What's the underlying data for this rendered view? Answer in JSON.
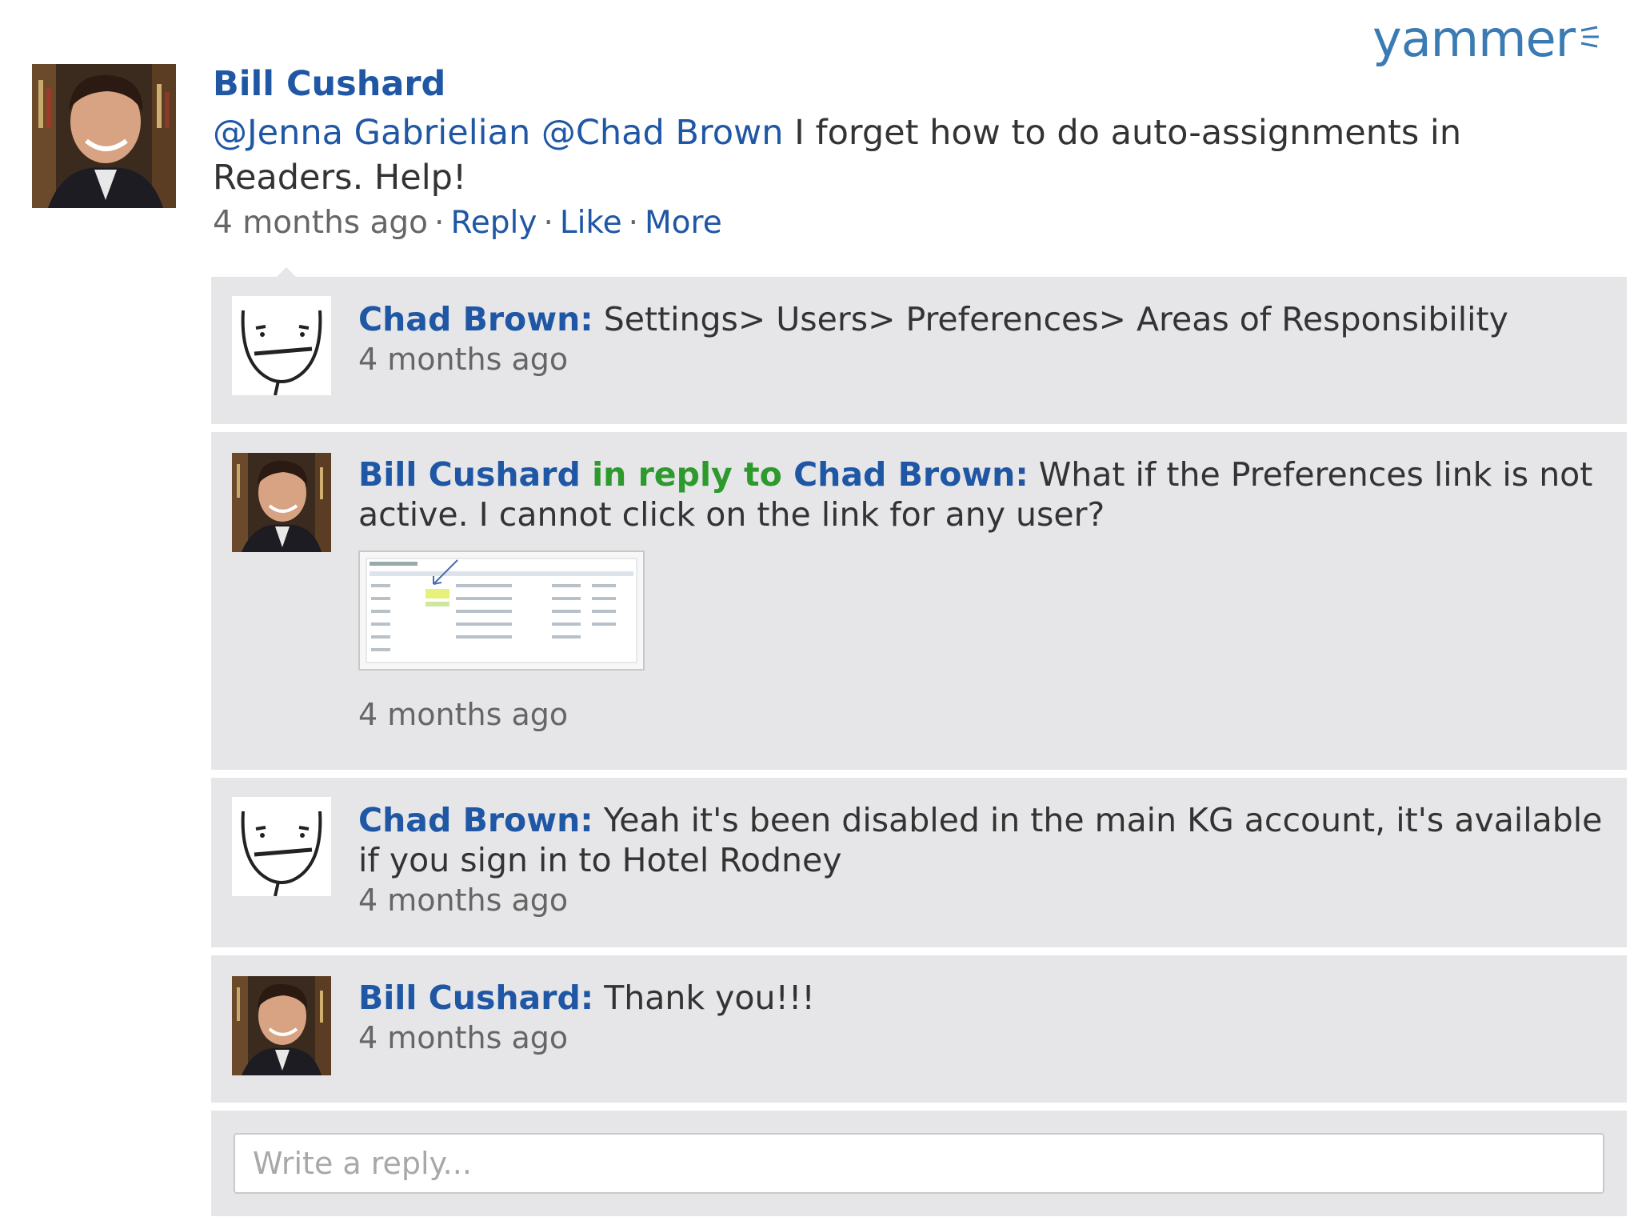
{
  "brand": {
    "logo_text": "yammer"
  },
  "post": {
    "author": "Bill Cushard",
    "mentions": [
      "@Jenna Gabrielian",
      "@Chad Brown"
    ],
    "text": " I forget how to do auto-assignments in Readers. Help!",
    "time": "4 months ago",
    "sep": "·",
    "actions": {
      "reply": "Reply",
      "like": "Like",
      "more": "More"
    }
  },
  "replies": [
    {
      "author": "Chad Brown:",
      "text": " Settings> Users> Preferences> Areas of Responsibility",
      "time": "4 months ago"
    },
    {
      "author": "Bill Cushard",
      "in_reply_to": " in reply to ",
      "reply_target": "Chad Brown:",
      "text": " What if the Preferences link is not active. I cannot click on the link for any user?",
      "time": "4 months ago"
    },
    {
      "author": "Chad Brown:",
      "text": " Yeah it's been disabled in the main KG account, it's available if you sign in to Hotel Rodney",
      "time": "4 months ago"
    },
    {
      "author": "Bill Cushard:",
      "text": " Thank you!!!",
      "time": "4 months ago"
    }
  ],
  "reply_box": {
    "placeholder": "Write a reply..."
  },
  "colors": {
    "link": "#1f57a5",
    "in_reply": "#2e9a2e",
    "panel": "#e6e6e8",
    "brand": "#3a7bb3"
  },
  "icons": [
    "bill-cushard-photo-avatar",
    "chad-brown-poker-face-avatar",
    "yammer-waves-icon",
    "screenshot-thumbnail"
  ]
}
